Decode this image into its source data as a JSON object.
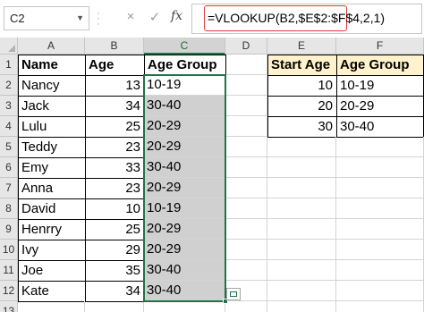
{
  "formula_bar": {
    "name_box": "C2",
    "cancel_icon": "×",
    "enter_icon": "✓",
    "fx_label": "fx",
    "formula": "=VLOOKUP(B2,$E$2:$F$4,2,1)"
  },
  "columns": [
    "A",
    "B",
    "C",
    "D",
    "E",
    "F"
  ],
  "rows": [
    "1",
    "2",
    "3",
    "4",
    "5",
    "6",
    "7",
    "8",
    "9",
    "10",
    "11",
    "12",
    "13"
  ],
  "table": {
    "headers": {
      "name": "Name",
      "age": "Age",
      "group": "Age Group"
    },
    "rows": [
      {
        "name": "Nancy",
        "age": "13",
        "group": "10-19"
      },
      {
        "name": "Jack",
        "age": "34",
        "group": "30-40"
      },
      {
        "name": "Lulu",
        "age": "25",
        "group": "20-29"
      },
      {
        "name": "Teddy",
        "age": "23",
        "group": "20-29"
      },
      {
        "name": "Emy",
        "age": "33",
        "group": "30-40"
      },
      {
        "name": "Anna",
        "age": "23",
        "group": "20-29"
      },
      {
        "name": "David",
        "age": "10",
        "group": "10-19"
      },
      {
        "name": "Henrry",
        "age": "25",
        "group": "20-29"
      },
      {
        "name": "Ivy",
        "age": "29",
        "group": "20-29"
      },
      {
        "name": "Joe",
        "age": "35",
        "group": "30-40"
      },
      {
        "name": "Kate",
        "age": "34",
        "group": "30-40"
      }
    ]
  },
  "lookup": {
    "headers": {
      "start": "Start Age",
      "group": "Age Group"
    },
    "rows": [
      {
        "start": "10",
        "group": "10-19"
      },
      {
        "start": "20",
        "group": "20-29"
      },
      {
        "start": "30",
        "group": "30-40"
      }
    ]
  },
  "colors": {
    "selection": "#217346",
    "header_fill": "#fff2cc",
    "result_fill": "#d0d0d0",
    "formula_highlight": "#e63c3c"
  }
}
